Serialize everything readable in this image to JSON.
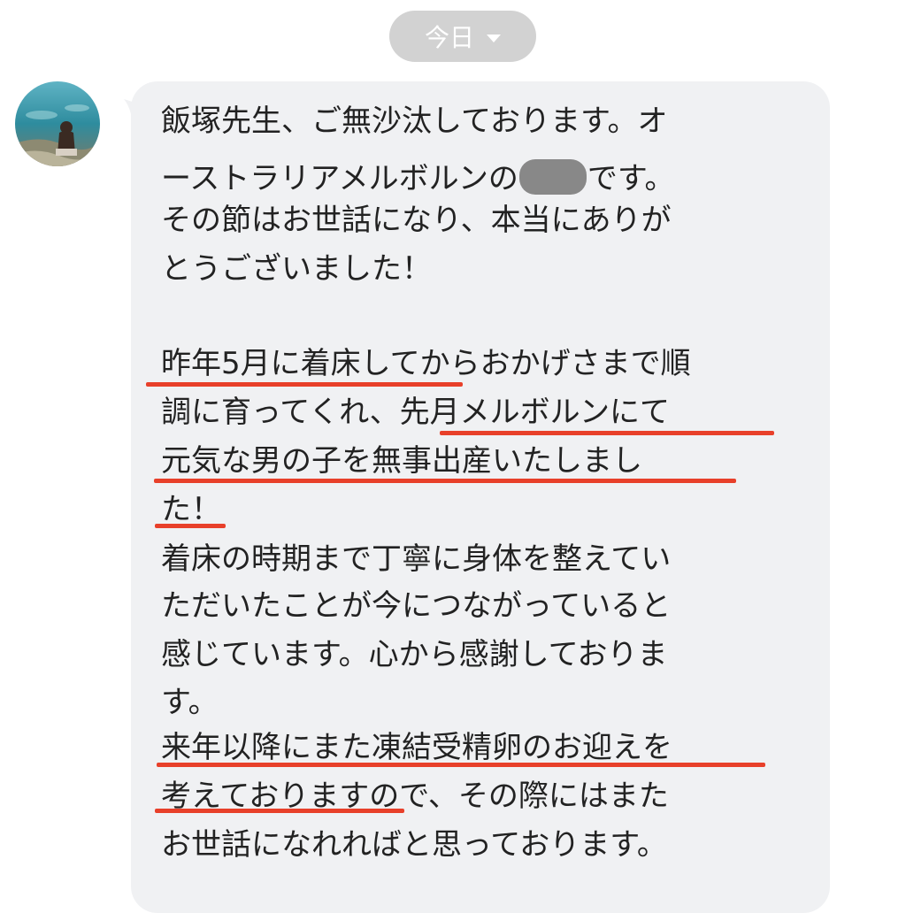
{
  "header": {
    "date_label": "今日"
  },
  "message": {
    "line1": "飯塚先生、ご無沙汰しております。オ",
    "line2_before": "ーストラリアメルボルンの",
    "line2_after": "です。",
    "line3": "その節はお世話になり、本当にありが",
    "line4": "とうございました！",
    "line5": "昨年5月に着床してからおかげさまで順",
    "line6": "調に育ってくれ、先月メルボルンにて",
    "line7": "元気な男の子を無事出産いたしまし",
    "line8": "た！",
    "line9": "着床の時期まで丁寧に身体を整えてい",
    "line10": "ただいたことが今につながっていると",
    "line11": "感じています。心から感謝しておりま",
    "line12": "す。",
    "line13": "来年以降にまた凍結受精卵のお迎えを",
    "line14": "考えておりますので、その際にはまた",
    "line15": "お世話になれればと思っております。"
  },
  "colors": {
    "bubble": "#f0f1f3",
    "underline": "#e8402a",
    "pill": "#d2d2d2"
  },
  "icons": {
    "dropdown": "caret-down-icon",
    "avatar": "beach-photo-avatar"
  }
}
